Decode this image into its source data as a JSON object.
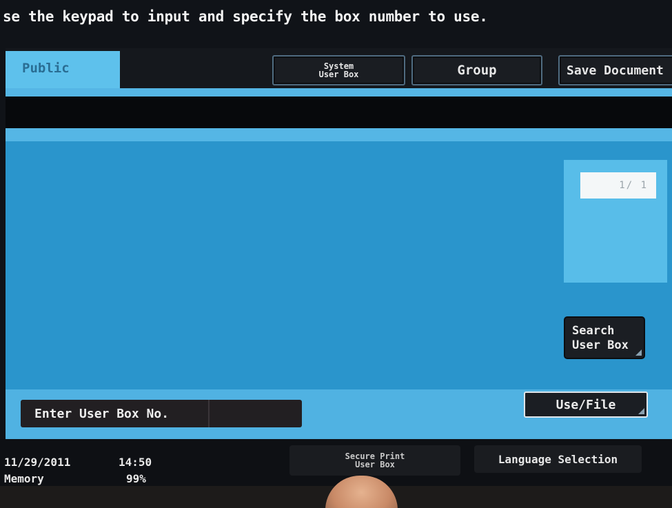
{
  "instruction": "se the keypad to input and specify the box number to use.",
  "tabs": {
    "public": "Public",
    "system_user_box_line1": "System",
    "system_user_box_line2": "User Box",
    "group": "Group",
    "save_document": "Save Document"
  },
  "pager": {
    "text": "1/  1"
  },
  "search": {
    "line1": "Search",
    "line2": "User Box"
  },
  "entry": {
    "label": "Enter User Box No.",
    "value": ""
  },
  "use_file": "Use/File",
  "status": {
    "date": "11/29/2011",
    "time": "14:50",
    "memory_label": "Memory",
    "memory_value": "99%"
  },
  "secure_print": {
    "line1": "Secure Print",
    "line2": "User Box"
  },
  "language_selection": "Language Selection",
  "colors": {
    "panel_blue": "#55b6e5",
    "list_blue": "#2a95cc",
    "tab_active": "#5ec1ec",
    "button_dark": "#1b1e23"
  }
}
